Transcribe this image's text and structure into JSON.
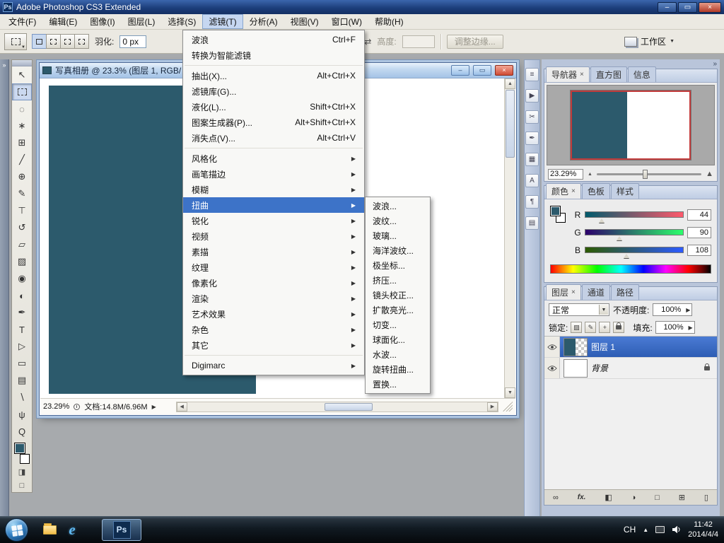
{
  "titlebar": {
    "icon_label": "Ps",
    "title": "Adobe Photoshop CS3 Extended"
  },
  "menubar": {
    "items": [
      "文件(F)",
      "编辑(E)",
      "图像(I)",
      "图层(L)",
      "选择(S)",
      "滤镜(T)",
      "分析(A)",
      "视图(V)",
      "窗口(W)",
      "帮助(H)"
    ]
  },
  "options": {
    "feather_label": "羽化:",
    "feather_value": "0 px",
    "height_label": "高度:",
    "height_value": "",
    "refine_edge_label": "调整边缘...",
    "workspace_label": "工作区"
  },
  "filter_menu": {
    "items": [
      {
        "label": "波浪",
        "shortcut": "Ctrl+F"
      },
      {
        "label": "转换为智能滤镜",
        "shortcut": ""
      },
      {
        "label": "抽出(X)...",
        "shortcut": "Alt+Ctrl+X"
      },
      {
        "label": "滤镜库(G)...",
        "shortcut": ""
      },
      {
        "label": "液化(L)...",
        "shortcut": "Shift+Ctrl+X"
      },
      {
        "label": "图案生成器(P)...",
        "shortcut": "Alt+Shift+Ctrl+X"
      },
      {
        "label": "消失点(V)...",
        "shortcut": "Alt+Ctrl+V"
      },
      {
        "label": "风格化"
      },
      {
        "label": "画笔描边"
      },
      {
        "label": "模糊"
      },
      {
        "label": "扭曲"
      },
      {
        "label": "锐化"
      },
      {
        "label": "视频"
      },
      {
        "label": "素描"
      },
      {
        "label": "纹理"
      },
      {
        "label": "像素化"
      },
      {
        "label": "渲染"
      },
      {
        "label": "艺术效果"
      },
      {
        "label": "杂色"
      },
      {
        "label": "其它"
      },
      {
        "label": "Digimarc"
      }
    ]
  },
  "distort_submenu": {
    "items": [
      {
        "label": "波浪..."
      },
      {
        "label": "波纹..."
      },
      {
        "label": "玻璃..."
      },
      {
        "label": "海洋波纹..."
      },
      {
        "label": "极坐标..."
      },
      {
        "label": "挤压..."
      },
      {
        "label": "镜头校正..."
      },
      {
        "label": "扩散亮光..."
      },
      {
        "label": "切变..."
      },
      {
        "label": "球面化..."
      },
      {
        "label": "水波..."
      },
      {
        "label": "旋转扭曲..."
      },
      {
        "label": "置换..."
      }
    ]
  },
  "document": {
    "title": "写真相册 @ 23.3% (图层 1, RGB/",
    "zoom": "23.29%",
    "doc_size": "文档:14.8M/6.96M"
  },
  "toolbox": {
    "tools": [
      {
        "name": "move",
        "glyph": "↖"
      },
      {
        "name": "rectangular-marquee",
        "glyph": ""
      },
      {
        "name": "lasso",
        "glyph": "◌"
      },
      {
        "name": "quick-selection",
        "glyph": "∗"
      },
      {
        "name": "crop",
        "glyph": "⊞"
      },
      {
        "name": "slice",
        "glyph": "╱"
      },
      {
        "name": "spot-healing-brush",
        "glyph": "⊕"
      },
      {
        "name": "brush",
        "glyph": "✎"
      },
      {
        "name": "clone-stamp",
        "glyph": "⊤"
      },
      {
        "name": "history-brush",
        "glyph": "↺"
      },
      {
        "name": "eraser",
        "glyph": "▱"
      },
      {
        "name": "gradient",
        "glyph": "▨"
      },
      {
        "name": "blur",
        "glyph": "◉"
      },
      {
        "name": "dodge",
        "glyph": "◐"
      },
      {
        "name": "pen",
        "glyph": "✒"
      },
      {
        "name": "type",
        "glyph": "T"
      },
      {
        "name": "path-selection",
        "glyph": "▷"
      },
      {
        "name": "shape",
        "glyph": "▭"
      },
      {
        "name": "notes",
        "glyph": "▤"
      },
      {
        "name": "eyedropper",
        "glyph": "∖"
      },
      {
        "name": "hand",
        "glyph": "ψ"
      },
      {
        "name": "zoom",
        "glyph": "Q"
      }
    ],
    "quick_mask_glyph": "◨",
    "screen_mode_glyph": "□"
  },
  "dock_icons": [
    {
      "name": "brushes",
      "glyph": "≡"
    },
    {
      "name": "actions",
      "glyph": "▶"
    },
    {
      "name": "scissors",
      "glyph": "✂"
    },
    {
      "name": "pen-presets",
      "glyph": "✒"
    },
    {
      "name": "swatches",
      "glyph": "▦"
    },
    {
      "name": "character",
      "glyph": "A"
    },
    {
      "name": "paragraph",
      "glyph": "¶"
    },
    {
      "name": "layer-comps",
      "glyph": "▤"
    }
  ],
  "navigator": {
    "tabs": [
      "导航器",
      "直方图",
      "信息"
    ],
    "zoom": "23.29%"
  },
  "color_panel": {
    "tabs": [
      "颜色",
      "色板",
      "样式"
    ],
    "channels": [
      {
        "label": "R",
        "value": "44"
      },
      {
        "label": "G",
        "value": "90"
      },
      {
        "label": "B",
        "value": "108"
      }
    ]
  },
  "layers_panel": {
    "tabs": [
      "图层",
      "通道",
      "路径"
    ],
    "blend_mode": "正常",
    "opacity_label": "不透明度:",
    "opacity_value": "100%",
    "lock_label": "锁定:",
    "fill_label": "填充:",
    "fill_value": "100%",
    "lock_icons": [
      {
        "name": "lock-transparent",
        "glyph": "▨"
      },
      {
        "name": "lock-image",
        "glyph": "✎"
      },
      {
        "name": "lock-position",
        "glyph": "+"
      }
    ],
    "layers": [
      {
        "name": "图层 1"
      },
      {
        "name": "背景"
      }
    ],
    "bottom_icons": [
      {
        "name": "link-layers",
        "glyph": "∞"
      },
      {
        "name": "layer-style",
        "glyph": "fx."
      },
      {
        "name": "layer-mask",
        "glyph": "◧"
      },
      {
        "name": "adjustment-layer",
        "glyph": "◑"
      },
      {
        "name": "layer-group",
        "glyph": "□"
      },
      {
        "name": "new-layer",
        "glyph": "⊞"
      },
      {
        "name": "delete-layer",
        "glyph": "▯"
      }
    ]
  },
  "taskbar": {
    "ps_button": "Ps",
    "tray": {
      "lang": "CH",
      "time": "11:42",
      "date": "2014/4/4"
    }
  },
  "icons": {
    "close_tab": "×",
    "menu_arrow": "▶",
    "dropdown": "▼",
    "combo_arrow": "▶",
    "collapse_right": "»",
    "collapse_left": "»",
    "minimize": "–",
    "maximize": "▭",
    "close": "×",
    "status_arrow": "▶",
    "scroll_up": "▲",
    "scroll_down": "▼",
    "scroll_left": "◀",
    "scroll_right": "▶",
    "zoom_small": "▲",
    "zoom_large": "▲",
    "swap": "⇄",
    "tool_arrow": "▼"
  },
  "colors": {
    "foreground": "#2C5A6C",
    "canvas": "#2C5A6C",
    "menu_highlight": "#3D73C8",
    "layer_selected": "#3869C2",
    "navigator_viewbox": "#C23B3B"
  }
}
